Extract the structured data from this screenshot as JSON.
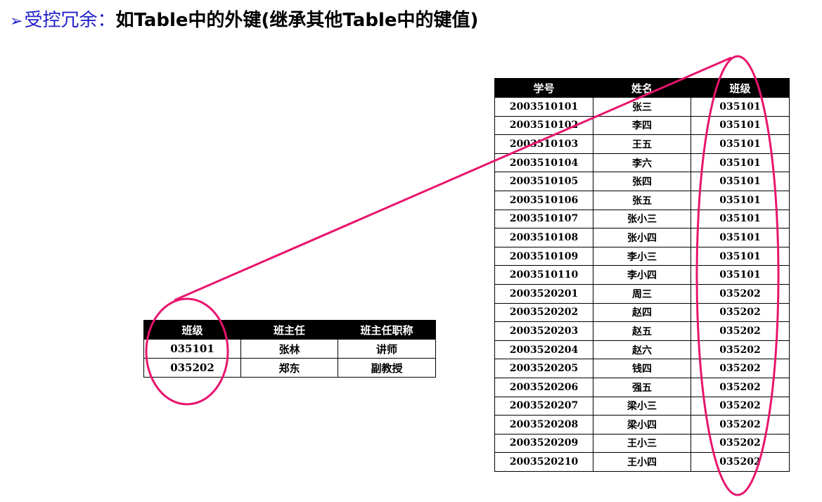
{
  "title": {
    "arrow": "➢",
    "lead": "受控冗余：",
    "rest": "如Table中的外键(继承其他Table中的键值)"
  },
  "left_table": {
    "headers": [
      "班级",
      "班主任",
      "班主任职称"
    ],
    "rows": [
      [
        "035101",
        "张林",
        "讲师"
      ],
      [
        "035202",
        "郑东",
        "副教授"
      ]
    ]
  },
  "right_table": {
    "headers": [
      "学号",
      "姓名",
      "班级"
    ],
    "rows": [
      [
        "2003510101",
        "张三",
        "035101"
      ],
      [
        "2003510102",
        "李四",
        "035101"
      ],
      [
        "2003510103",
        "王五",
        "035101"
      ],
      [
        "2003510104",
        "李六",
        "035101"
      ],
      [
        "2003510105",
        "张四",
        "035101"
      ],
      [
        "2003510106",
        "张五",
        "035101"
      ],
      [
        "2003510107",
        "张小三",
        "035101"
      ],
      [
        "2003510108",
        "张小四",
        "035101"
      ],
      [
        "2003510109",
        "李小三",
        "035101"
      ],
      [
        "2003510110",
        "李小四",
        "035101"
      ],
      [
        "2003520201",
        "周三",
        "035202"
      ],
      [
        "2003520202",
        "赵四",
        "035202"
      ],
      [
        "2003520203",
        "赵五",
        "035202"
      ],
      [
        "2003520204",
        "赵六",
        "035202"
      ],
      [
        "2003520205",
        "钱四",
        "035202"
      ],
      [
        "2003520206",
        "强五",
        "035202"
      ],
      [
        "2003520207",
        "梁小三",
        "035202"
      ],
      [
        "2003520208",
        "梁小四",
        "035202"
      ],
      [
        "2003520209",
        "王小三",
        "035202"
      ],
      [
        "2003520210",
        "王小四",
        "035202"
      ]
    ]
  },
  "colors": {
    "highlight": "#e8146e",
    "title_lead": "#2222cc",
    "header_bg": "#000000"
  }
}
